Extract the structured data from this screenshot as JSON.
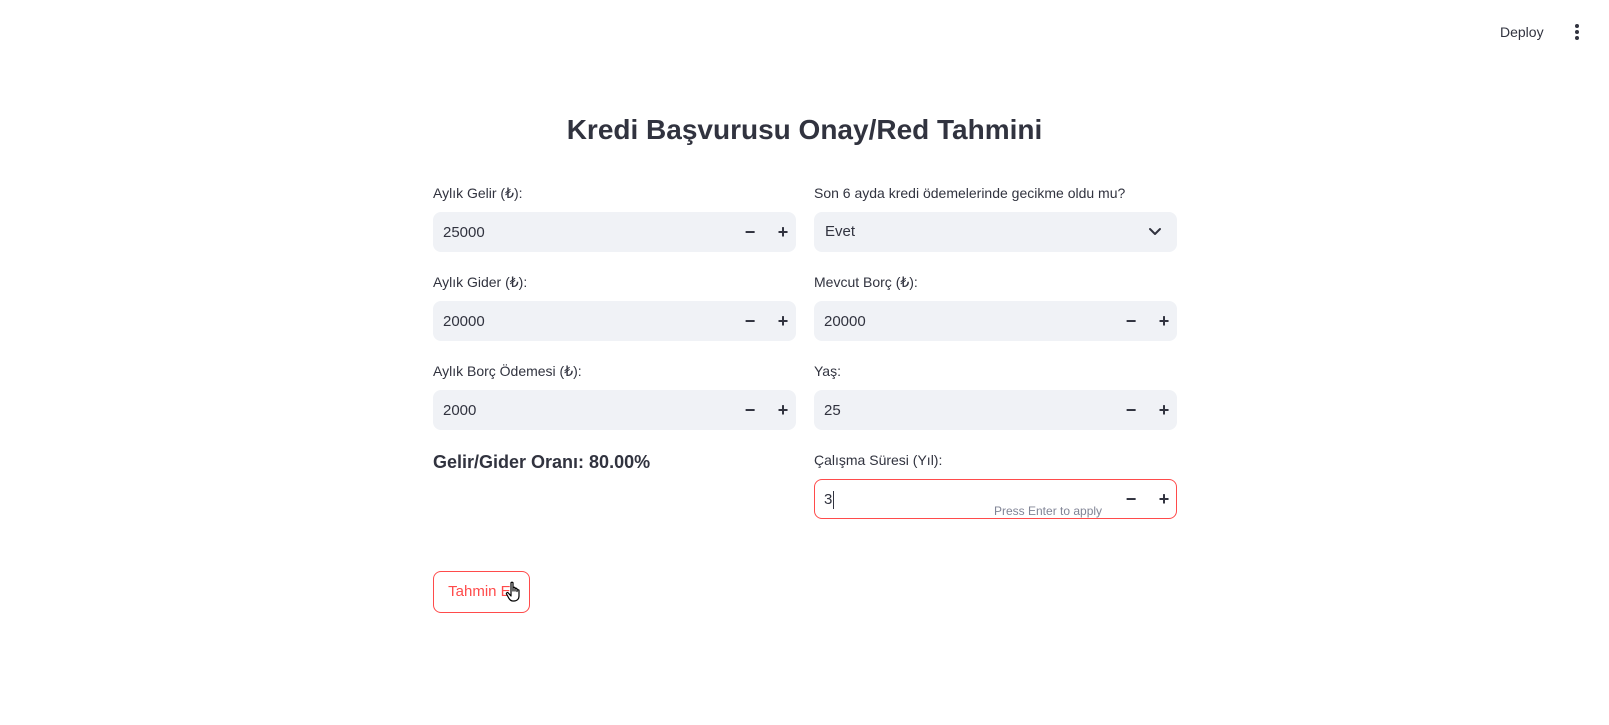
{
  "header": {
    "deploy_label": "Deploy",
    "menu_icon": "more-vertical-icon"
  },
  "page": {
    "title": "Kredi Başvurusu Onay/Red Tahmini"
  },
  "form": {
    "income": {
      "label": "Aylık Gelir (₺):",
      "value": "25000"
    },
    "expense": {
      "label": "Aylık Gider (₺):",
      "value": "20000"
    },
    "debt_payment": {
      "label": "Aylık Borç Ödemesi (₺):",
      "value": "2000"
    },
    "late_payment": {
      "label": "Son 6 ayda kredi ödemelerinde gecikme oldu mu?",
      "selected": "Evet"
    },
    "current_debt": {
      "label": "Mevcut Borç (₺):",
      "value": "20000"
    },
    "age": {
      "label": "Yaş:",
      "value": "25"
    },
    "work_years": {
      "label": "Çalışma Süresi (Yıl):",
      "value": "3",
      "hint": "Press Enter to apply"
    },
    "stepper_minus": "−",
    "stepper_plus": "+"
  },
  "result": {
    "ratio_text": "Gelir/Gider Oranı: 80.00%"
  },
  "actions": {
    "predict_label": "Tahmin Et"
  },
  "colors": {
    "accent": "#ff4b4b",
    "input_bg": "#f0f2f6",
    "text": "#31333f"
  }
}
